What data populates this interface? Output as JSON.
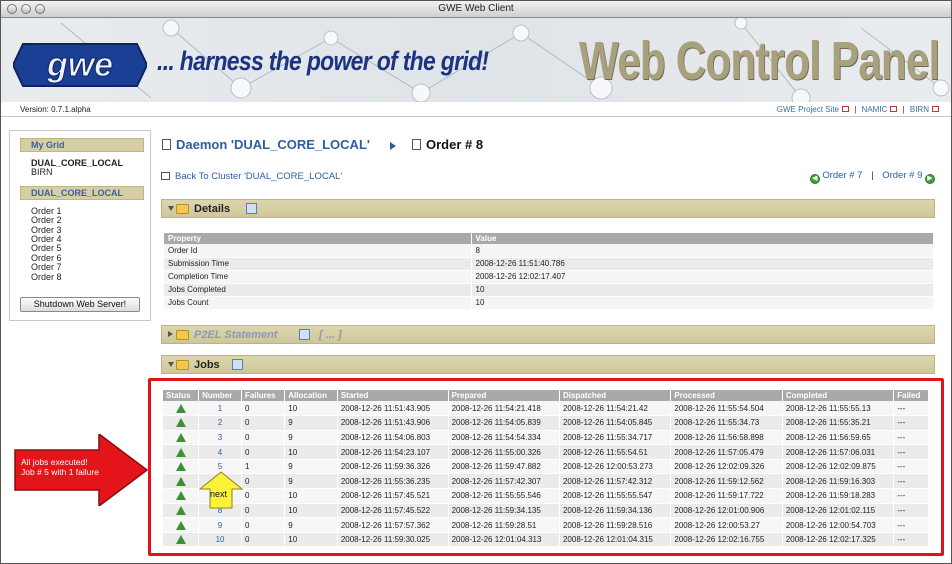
{
  "window": {
    "title": "GWE Web Client"
  },
  "banner": {
    "tagline": "... harness the power of the grid!",
    "title": "Web Control Panel",
    "logo_text": "gwe"
  },
  "versionbar": {
    "version": "Version: 0.7.1.alpha",
    "links": [
      "GWE Project Site",
      "NAMIC",
      "BIRN"
    ],
    "separator": "|"
  },
  "sidebar": {
    "my_grid_label": "My Grid",
    "clusters": [
      "DUAL_CORE_LOCAL",
      "BIRN"
    ],
    "cluster_heading": "DUAL_CORE_LOCAL",
    "orders": [
      "Order 1",
      "Order 2",
      "Order 3",
      "Order 4",
      "Order 5",
      "Order 6",
      "Order 7",
      "Order 8"
    ],
    "shutdown_label": "Shutdown Web Server!"
  },
  "breadcrumb": {
    "daemon": "Daemon 'DUAL_CORE_LOCAL'",
    "order": "Order # 8"
  },
  "back_link": "Back To Cluster 'DUAL_CORE_LOCAL'",
  "order_nav": {
    "prev": "Order # 7",
    "separator": "|",
    "next": "Order # 9"
  },
  "sections": {
    "details": "Details",
    "p2el": "P2EL Statement",
    "p2el_ellipsis": "[ ... ]",
    "jobs": "Jobs"
  },
  "details": {
    "headers": [
      "Property",
      "Value"
    ],
    "rows": [
      [
        "Order Id",
        "8"
      ],
      [
        "Submission Time",
        "2008-12-26 11:51:40.786"
      ],
      [
        "Completion Time",
        "2008-12-26 12:02:17.407"
      ],
      [
        "Jobs Completed",
        "10"
      ],
      [
        "Jobs Count",
        "10"
      ]
    ]
  },
  "jobs": {
    "headers": [
      "Status",
      "Number",
      "Failures",
      "Allocation",
      "Started",
      "Prepared",
      "Dispatched",
      "Processed",
      "Completed",
      "Failed"
    ],
    "rows": [
      [
        "1",
        "0",
        "10",
        "2008-12-26 11:51:43.905",
        "2008-12-26 11:54:21.418",
        "2008-12-26 11:54:21.42",
        "2008-12-26 11:55:54.504",
        "2008-12-26 11:55:55.13",
        "---"
      ],
      [
        "2",
        "0",
        "9",
        "2008-12-26 11:51:43.906",
        "2008-12-26 11:54:05.839",
        "2008-12-26 11:54:05.845",
        "2008-12-26 11:55:34.73",
        "2008-12-26 11:55:35.21",
        "---"
      ],
      [
        "3",
        "0",
        "9",
        "2008-12-26 11:54:06.803",
        "2008-12-26 11:54:54.334",
        "2008-12-26 11:55:34.717",
        "2008-12-26 11:56:58.898",
        "2008-12-26 11:56:59.65",
        "---"
      ],
      [
        "4",
        "0",
        "10",
        "2008-12-26 11:54:23.107",
        "2008-12-26 11:55:00.326",
        "2008-12-26 11:55:54.51",
        "2008-12-26 11:57:05.479",
        "2008-12-26 11:57:06.031",
        "---"
      ],
      [
        "5",
        "1",
        "9",
        "2008-12-26 11:59:36.326",
        "2008-12-26 11:59:47.882",
        "2008-12-26 12:00:53.273",
        "2008-12-26 12:02:09.326",
        "2008-12-26 12:02:09.875",
        "---"
      ],
      [
        "6",
        "0",
        "9",
        "2008-12-26 11:55:36.235",
        "2008-12-26 11:57:42.307",
        "2008-12-26 11:57:42.312",
        "2008-12-26 11:59:12.562",
        "2008-12-26 11:59:16.303",
        "---"
      ],
      [
        "7",
        "0",
        "10",
        "2008-12-26 11:57:45.521",
        "2008-12-26 11:55:55.546",
        "2008-12-26 11:55:55.547",
        "2008-12-26 11:59:17.722",
        "2008-12-26 11:59:18.283",
        "---"
      ],
      [
        "8",
        "0",
        "10",
        "2008-12-26 11:57:45.522",
        "2008-12-26 11:59:34.135",
        "2008-12-26 11:59:34.136",
        "2008-12-26 12:01:00.906",
        "2008-12-26 12:01:02.115",
        "---"
      ],
      [
        "9",
        "0",
        "9",
        "2008-12-26 11:57:57.362",
        "2008-12-26 11:59:28.51",
        "2008-12-26 11:59:28.516",
        "2008-12-26 12:00:53.27",
        "2008-12-26 12:00:54.703",
        "---"
      ],
      [
        "10",
        "0",
        "10",
        "2008-12-26 11:59:30.025",
        "2008-12-26 12:01:04.313",
        "2008-12-26 12:01:04.315",
        "2008-12-26 12:02:16.755",
        "2008-12-26 12:02:17.325",
        "---"
      ]
    ]
  },
  "annotations": {
    "callout_line1": "All jobs executed!",
    "callout_line2": "Job # 5 with 1 failure",
    "next_label": "next"
  },
  "colors": {
    "accent_blue": "#2f5e9e",
    "section_khaki": "#d6cfa4",
    "highlight_red": "#e0141a",
    "status_green": "#3e8f35"
  }
}
